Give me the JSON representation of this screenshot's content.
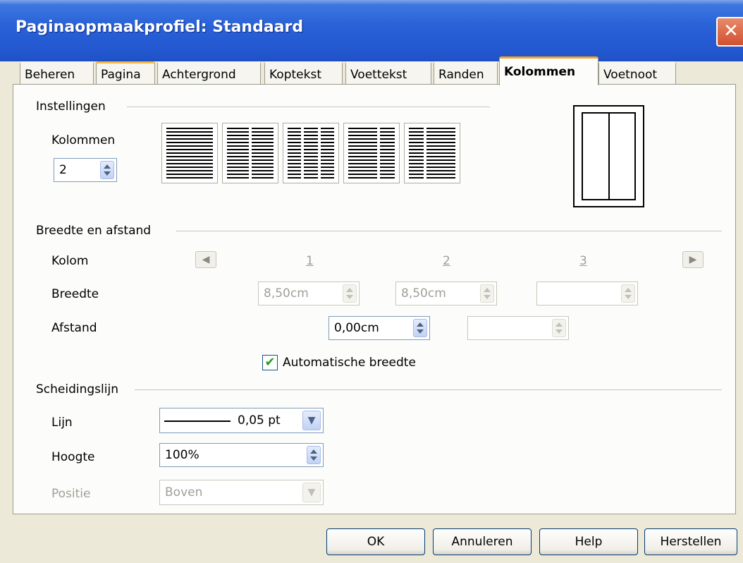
{
  "window": {
    "title": "Paginaopmaakprofiel: Standaard",
    "close_label": "✕"
  },
  "tabs": [
    {
      "label": "Beheren"
    },
    {
      "label": "Pagina"
    },
    {
      "label": "Achtergrond"
    },
    {
      "label": "Koptekst"
    },
    {
      "label": "Voettekst"
    },
    {
      "label": "Randen"
    },
    {
      "label": "Kolommen"
    },
    {
      "label": "Voetnoot"
    }
  ],
  "active_tab": "Kolommen",
  "settings": {
    "heading": "Instellingen",
    "columns_label": "Kolommen",
    "columns_value": "2"
  },
  "width_spacing": {
    "heading": "Breedte en afstand",
    "column_label": "Kolom",
    "col_numbers": [
      "1",
      "2",
      "3"
    ],
    "width_label": "Breedte",
    "widths": [
      "8,50cm",
      "8,50cm",
      ""
    ],
    "spacing_label": "Afstand",
    "spacings": [
      "0,00cm",
      ""
    ],
    "auto_width_label": "Automatische breedte",
    "auto_width_checked": true
  },
  "separator": {
    "heading": "Scheidingslijn",
    "line_label": "Lijn",
    "line_value": "0,05 pt",
    "height_label": "Hoogte",
    "height_value": "100%",
    "position_label": "Positie",
    "position_value": "Boven"
  },
  "buttons": {
    "ok": "OK",
    "cancel": "Annuleren",
    "help": "Help",
    "reset": "Herstellen"
  }
}
